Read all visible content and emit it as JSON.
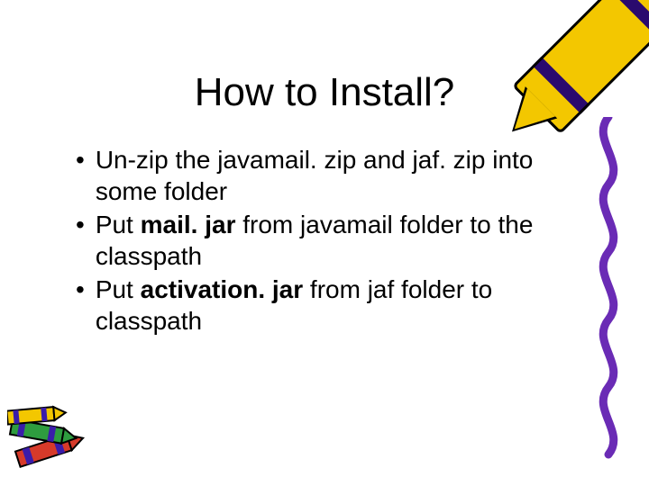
{
  "title": "How to Install?",
  "bullets": [
    {
      "dot": "•",
      "pre": "Un-zip the javamail. zip and jaf. zip into some folder",
      "bold": "",
      "post": ""
    },
    {
      "dot": "•",
      "pre": "Put ",
      "bold": "mail. jar",
      "post": " from javamail folder to the classpath"
    },
    {
      "dot": "•",
      "pre": "Put ",
      "bold": "activation. jar",
      "post": " from jaf folder to classpath"
    }
  ]
}
